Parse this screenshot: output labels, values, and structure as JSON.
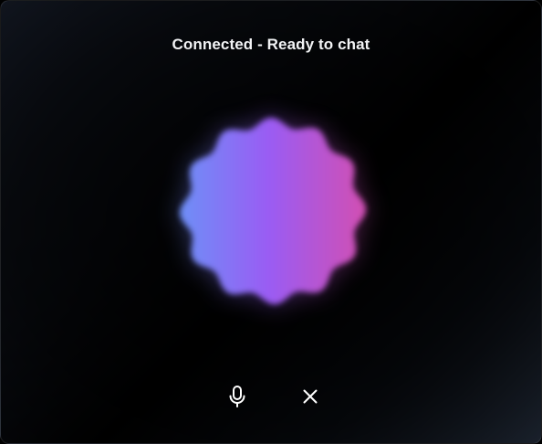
{
  "status": {
    "text": "Connected - Ready to chat"
  },
  "orb": {
    "gradient_colors": [
      "#6e8ff7",
      "#9a5cf3",
      "#d24fb2"
    ]
  },
  "controls": {
    "mic_icon": "microphone-icon",
    "close_icon": "close-icon",
    "icon_color": "#ffffff"
  }
}
